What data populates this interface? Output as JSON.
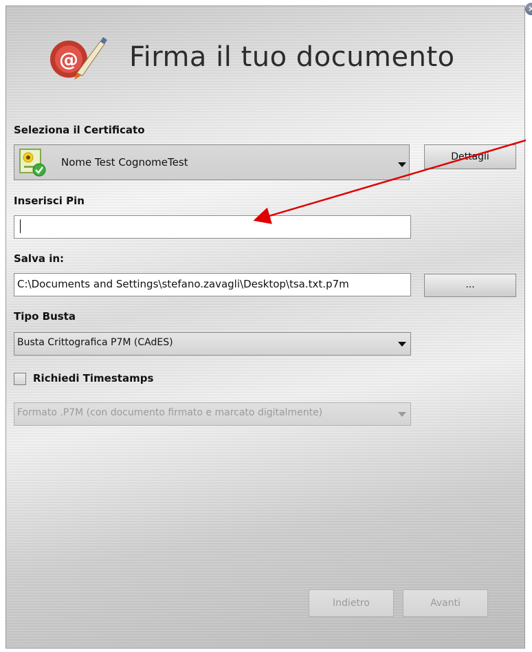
{
  "header": {
    "title": "Firma il tuo documento",
    "logo_icon": "seal-pen-icon",
    "close_icon": "close-icon"
  },
  "certificate": {
    "label": "Seleziona il Certificato",
    "selected": "Nome Test CognomeTest",
    "details_button": "Dettagli"
  },
  "pin": {
    "label": "Inserisci Pin",
    "value": ""
  },
  "save": {
    "label": "Salva in:",
    "path": "C:\\Documents and Settings\\stefano.zavagli\\Desktop\\tsa.txt.p7m",
    "browse_button": "..."
  },
  "envelope": {
    "label": "Tipo Busta",
    "selected": "Busta Crittografica P7M (CAdES)"
  },
  "timestamp": {
    "label": "Richiedi Timestamps",
    "checked": false,
    "format_selected": "Formato .P7M (con documento firmato e marcato digitalmente)"
  },
  "footer": {
    "back_button": "Indietro",
    "next_button": "Avanti"
  },
  "colors": {
    "annotation_arrow": "#e00000",
    "background": "#e6e6e6"
  }
}
